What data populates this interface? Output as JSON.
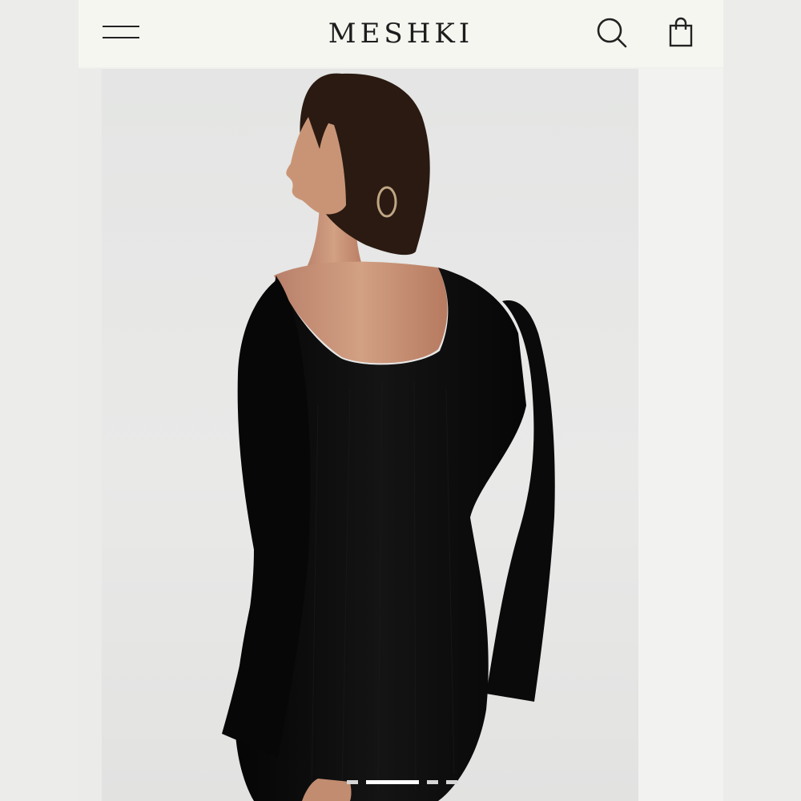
{
  "header": {
    "brand": "MESHKI",
    "menu_icon": "hamburger-menu-icon",
    "search_icon": "search-icon",
    "bag_icon": "shopping-bag-icon"
  },
  "gallery": {
    "slide_count": 4,
    "active_slide": 2,
    "image_subject": "model-back-view-black-mini-dress"
  },
  "colors": {
    "header_bg": "#f6f6f1",
    "brand_text": "#1d1d1d",
    "dress": "#0d0d0d",
    "skin": "#c99476",
    "hair": "#2a1a12"
  }
}
